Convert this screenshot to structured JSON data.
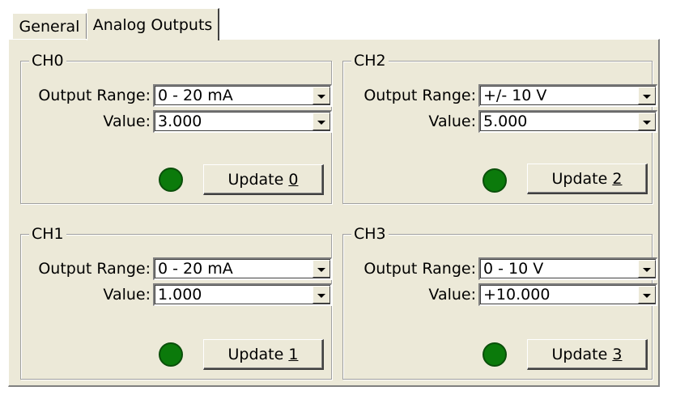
{
  "tabs": [
    {
      "label": "General",
      "active": false
    },
    {
      "label": "Analog Outputs",
      "active": true
    }
  ],
  "channels": {
    "ch0": {
      "title": "CH0",
      "range_label": "Output Range:",
      "range_value": "0 - 20 mA",
      "value_label": "Value:",
      "value": "3.000",
      "update_text": "Update ",
      "update_key": "0",
      "led_color": "#0b7a0b"
    },
    "ch1": {
      "title": "CH1",
      "range_label": "Output Range:",
      "range_value": "0 - 20 mA",
      "value_label": "Value:",
      "value": "1.000",
      "update_text": "Update ",
      "update_key": "1",
      "led_color": "#0b7a0b"
    },
    "ch2": {
      "title": "CH2",
      "range_label": "Output Range:",
      "range_value": "+/- 10 V",
      "value_label": "Value:",
      "value": "5.000",
      "update_text": "Update ",
      "update_key": "2",
      "led_color": "#0b7a0b"
    },
    "ch3": {
      "title": "CH3",
      "range_label": "Output Range:",
      "range_value": "0 - 10 V",
      "value_label": "Value:",
      "value": "+10.000",
      "update_text": "Update ",
      "update_key": "3",
      "led_color": "#0b7a0b"
    }
  },
  "icons": {
    "dropdown": "chevron-down-icon",
    "status": "status-led-icon"
  }
}
